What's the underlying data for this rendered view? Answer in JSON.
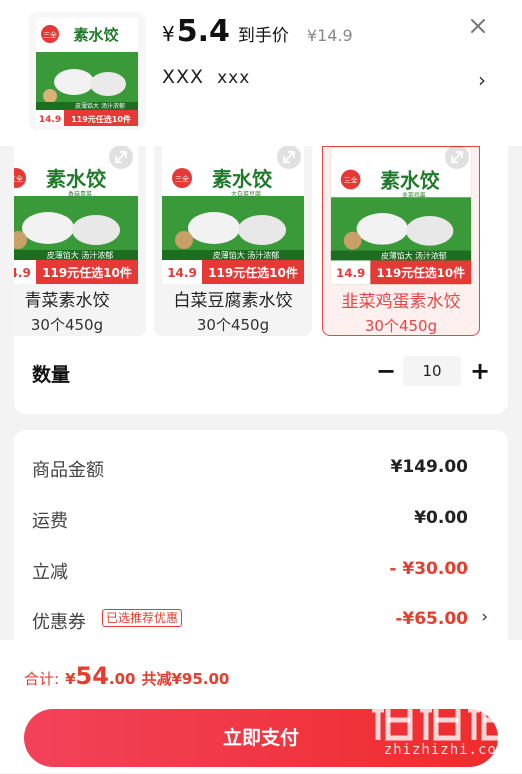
{
  "header": {
    "price_symbol": "¥",
    "price_value": "5.4",
    "price_suffix": "到手价",
    "original_price": "¥14.9",
    "address_main": "XXX",
    "address_sub": "xxx"
  },
  "product_thumb": {
    "brand": "三全",
    "title": "素水饺",
    "promo_strip": "皮薄馅大 汤汁浓郁",
    "price_tag": "14.9",
    "deal_text": "119元任选10件"
  },
  "variants": [
    {
      "name": "青菜素水饺",
      "spec": "30个450g",
      "selected": false,
      "flavor": "香菇青菜"
    },
    {
      "name": "白菜豆腐素水饺",
      "spec": "30个450g",
      "selected": false,
      "flavor": "大白菜豆腐"
    },
    {
      "name": "韭菜鸡蛋素水饺",
      "spec": "30个450g",
      "selected": true,
      "flavor": "韭菜鸡蛋"
    }
  ],
  "quantity": {
    "label": "数量",
    "value": "10",
    "minus": "−",
    "plus": "+"
  },
  "summary": {
    "rows": [
      {
        "label": "商品金额",
        "value": "¥149.00"
      },
      {
        "label": "运费",
        "value": "¥0.00"
      },
      {
        "label": "立减",
        "value": "- ¥30.00"
      },
      {
        "label": "优惠券",
        "value": "-¥65.00"
      }
    ],
    "coupon_badge": "已选推荐优惠"
  },
  "footer": {
    "total_label": "合计:",
    "total_symbol": "¥",
    "total_int": "54",
    "total_dec": ".00",
    "saved_text": "共减¥95.00",
    "pay_button": "立即支付"
  },
  "watermark": {
    "text": "zhizhizhi.com"
  },
  "colors": {
    "accent_red": "#e63d2e",
    "package_green": "#2f9a3c",
    "selected_border": "#e84646"
  }
}
